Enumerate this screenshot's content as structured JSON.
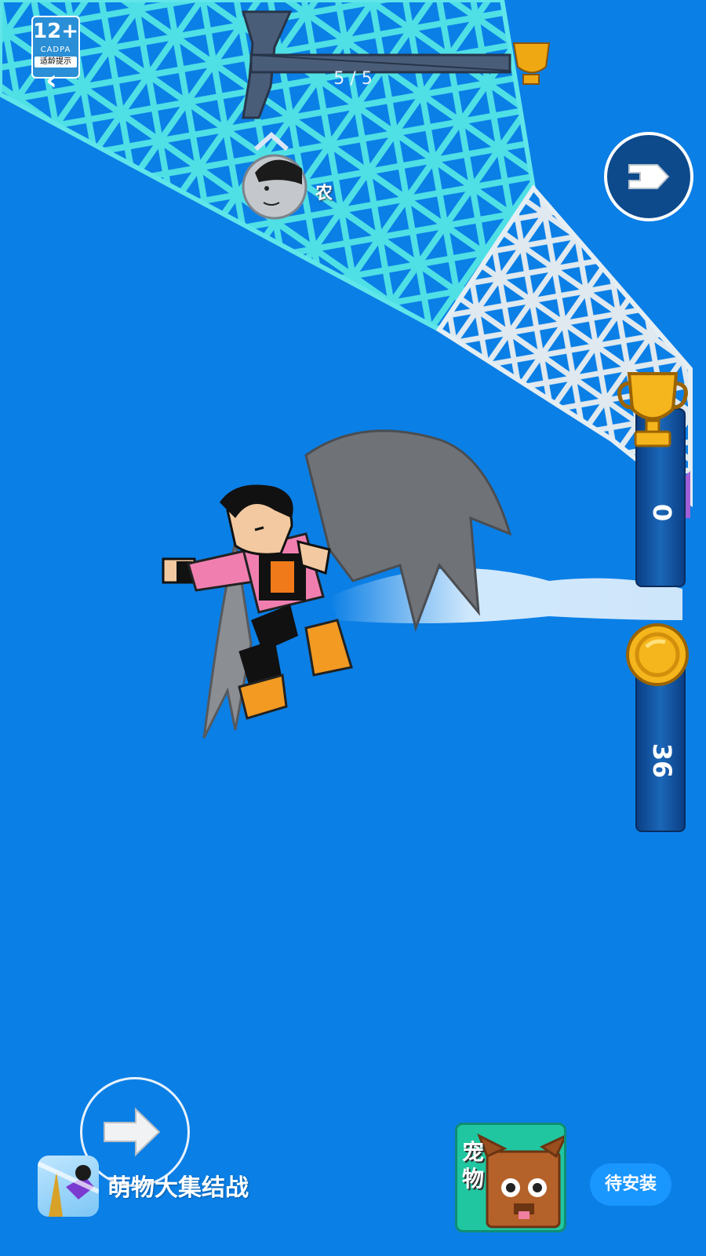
{
  "age_rating": {
    "label": "12+",
    "org": "CADPA",
    "tip": "适龄提示"
  },
  "hud": {
    "level_progress": "5 / 5",
    "player_name": "农",
    "trophy_count": "0",
    "coin_count": "36"
  },
  "ad_banner": {
    "app_name": "萌物大集结战",
    "pet_label": "宠物",
    "install_label": "待安装"
  },
  "icons": {
    "back": "chevron-left-icon",
    "trophy": "trophy-icon",
    "coin": "coin-icon",
    "next": "next-arrow-icon",
    "joystick": "right-arrow-icon"
  },
  "colors": {
    "sky": "#0a7fe6",
    "tower_teal": "#4fd6e0",
    "tower_white": "#d6e7f0",
    "panel_blue": "#0d4a8c",
    "gold": "#f0a812",
    "install_button": "#1a96ff"
  }
}
